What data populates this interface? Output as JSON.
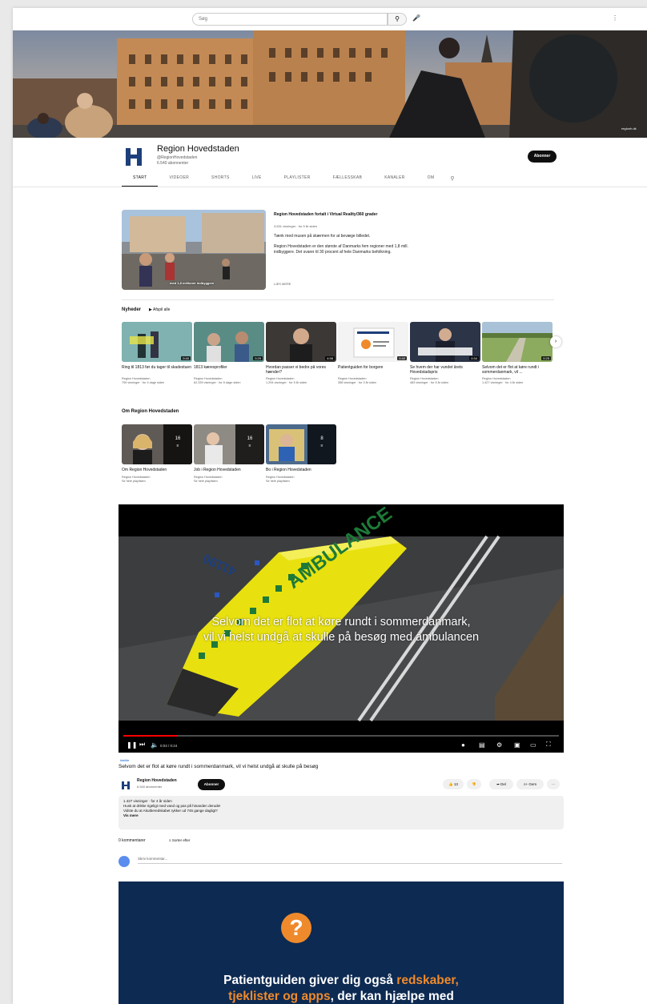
{
  "topbar": {
    "search_placeholder": "Søg"
  },
  "channel": {
    "name": "Region Hovedstaden",
    "handle": "@RegionHovedstaden",
    "subscribers": "6.540 abonnenter",
    "subscribe_label": "Abonner"
  },
  "tabs": [
    "START",
    "VIDEOER",
    "SHORTS",
    "LIVE",
    "PLAYLISTER",
    "FÆLLESSKAB",
    "KANALER",
    "OM"
  ],
  "featured": {
    "title": "Region Hovedstaden fortalt i Virtual Reality/360 grader",
    "meta": "3.631 visninger · for 5 år siden",
    "desc1": "Tænk med musen på skærmen for at bevæge billedet.",
    "desc2": "Region Hovedstaden er den største af Danmarks fem regioner med 1,8 mill. indbyggere. Det svarer til 30 procent af hele Danmarks befolkning.",
    "more": "LÆS MERE",
    "thumb_caption": "med 1,8 millioner indbyggere"
  },
  "news": {
    "heading": "Nyheder",
    "play_all": "Afspil alle",
    "videos": [
      {
        "title": "Ring til 1813 før du tager til skadestuen",
        "channel": "Region Hovedstaden",
        "meta": "795 visninger · for 4 dage siden",
        "duration": "0:40"
      },
      {
        "title": "1813 kæresprofiler",
        "channel": "Region Hovedstaden",
        "meta": "62.339 visninger · for 5 dage siden",
        "duration": "0:29"
      },
      {
        "title": "Hvordan passer vi bedre på vores hænder?",
        "channel": "Region Hovedstaden",
        "meta": "1.294 visninger · for 5 år siden",
        "duration": "4:58"
      },
      {
        "title": "Patientguiden for borgere",
        "channel": "Region Hovedstaden",
        "meta": "358 visninger · for 3 år siden",
        "duration": "0:40"
      },
      {
        "title": "Se hvem der har vundet årets Hovedstadspris",
        "channel": "Region Hovedstaden",
        "meta": "483 visninger · for 5 år siden",
        "duration": "0:34"
      },
      {
        "title": "Selvom det er flot at køre rundt i sommerdanmark, vil ...",
        "channel": "Region Hovedstaden",
        "meta": "1.427 visninger · for 4 år siden",
        "duration": "0:25"
      }
    ]
  },
  "about": {
    "heading": "Om Region Hovedstaden",
    "playlists": [
      {
        "title": "Om Region Hovedstaden",
        "channel": "Region Hovedstaden",
        "link": "Se hele playlisten",
        "count": "16"
      },
      {
        "title": "Job i Region Hovedstaden",
        "channel": "Region Hovedstaden",
        "link": "Se hele playlisten",
        "count": "16"
      },
      {
        "title": "Bo i Region Hovedstaden",
        "channel": "Region Hovedstaden",
        "link": "Se hele playlisten",
        "count": "8"
      }
    ]
  },
  "player": {
    "subtitle_line1": "Selvom det er flot at køre rundt i sommerdanmark,",
    "subtitle_line2": "vil vi helst undgå at skulle på besøg med ambulancen",
    "ambulance_text": "AMBULANCE",
    "unit_number": "41190",
    "time": "0:03 / 0:24",
    "progress": 0.125
  },
  "video": {
    "tag": "#skilte",
    "title": "Selvom det er flot at køre rundt i sommerdanmark, vil vi helst undgå at skulle på besøg",
    "owner": "Region Hovedstaden",
    "owner_subs": "6.540 abonnenter",
    "subscribe_label": "Abonner",
    "likes": "13",
    "share": "Del",
    "save": "Gem",
    "more": "···",
    "desc_meta": "1.427 visninger · for 4 år siden",
    "desc_line1": "Husk at drikke rigeligt med vand og pas på hinanden derude!",
    "desc_line2": "Vidste du at Akutberedskabet rykker ud 745 gange dagligt?",
    "desc_more": "Vis mere"
  },
  "comments": {
    "count": "0 kommentarer",
    "sort": "Sorter efter",
    "placeholder": "Skriv kommentar..."
  },
  "promo": {
    "badge": "?",
    "line1_a": "Patientguiden giver dig også ",
    "line1_b": "redskaber,",
    "line2_a": "tjeklister og apps",
    "line2_b": ", der kan hjælpe med"
  },
  "colors": {
    "accent": "#ef8a2c",
    "promo_bg": "#0d2a52",
    "ambulance": "#e8e10f",
    "progress": "#ff0000"
  }
}
